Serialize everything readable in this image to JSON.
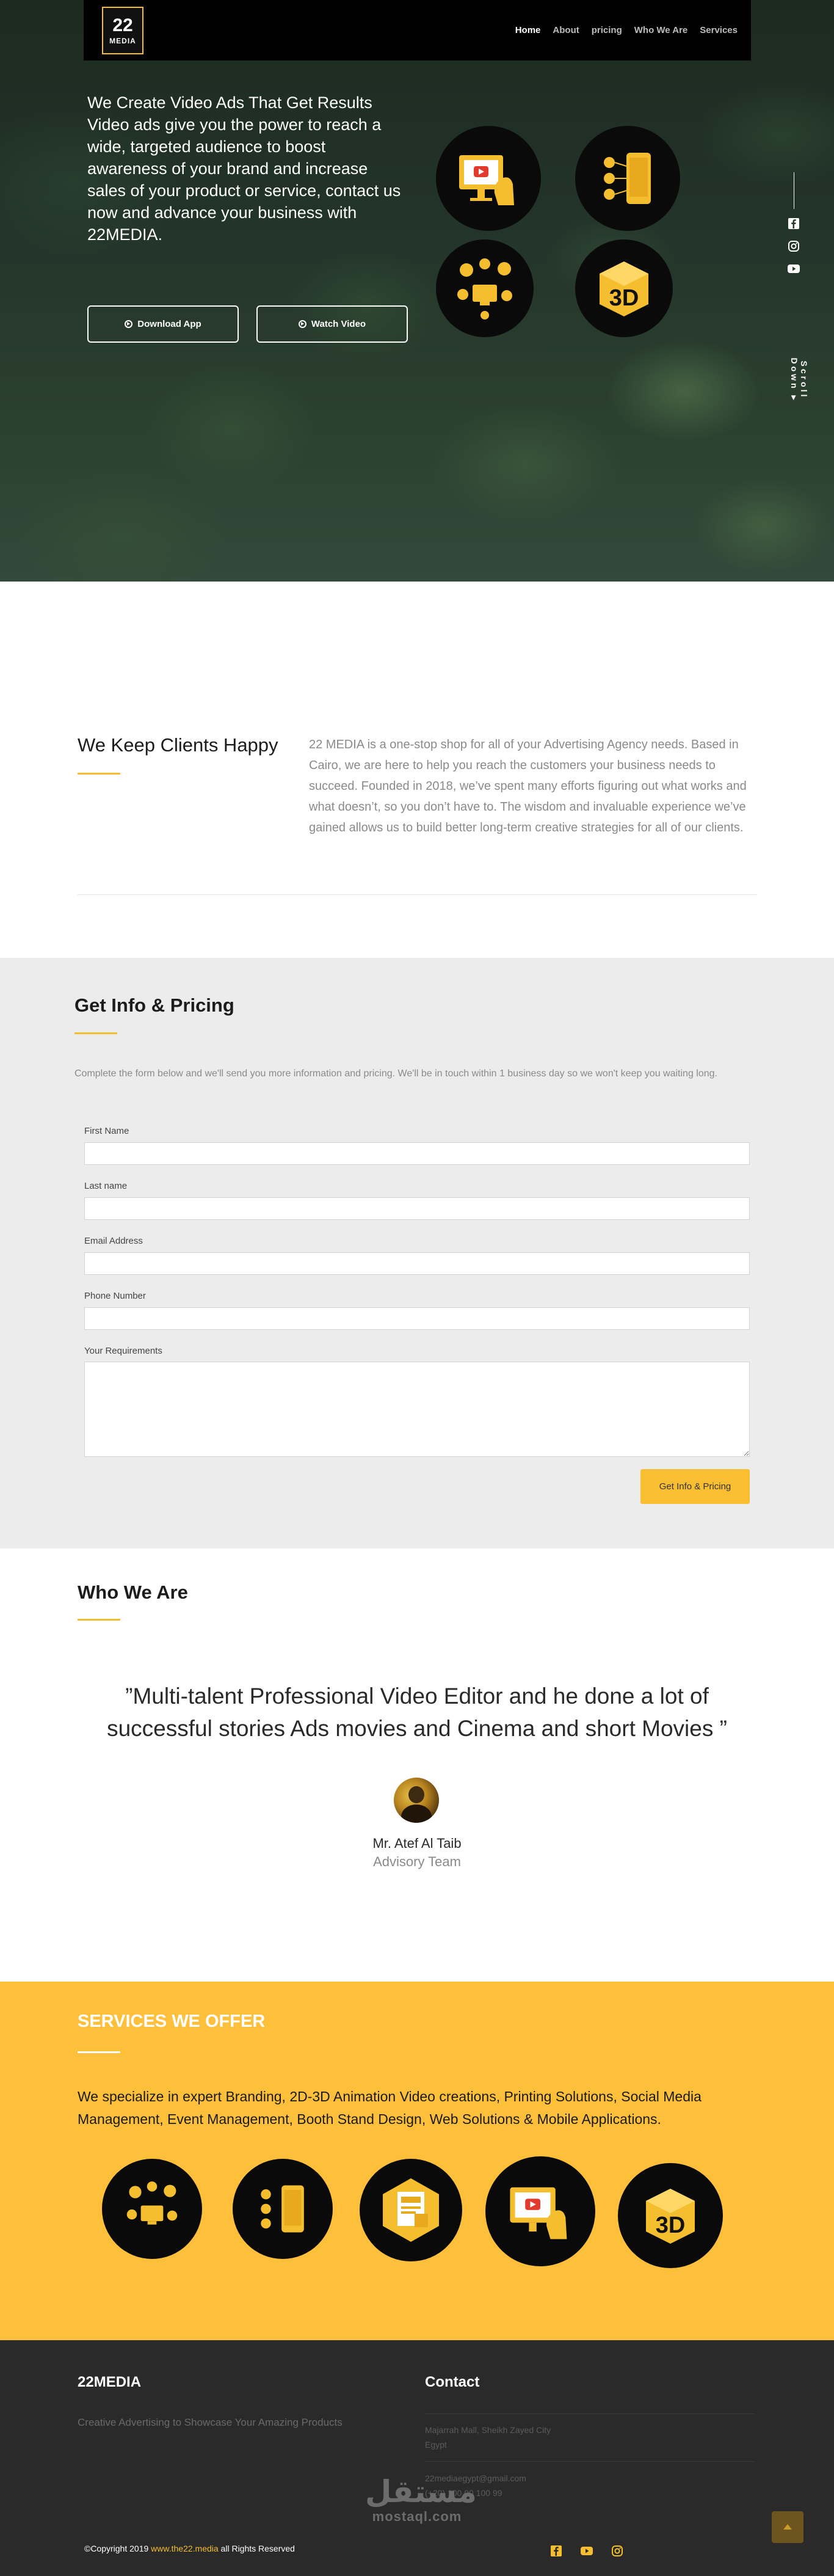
{
  "nav": {
    "logo_number": "22",
    "logo_text": "MEDIA",
    "links": [
      "Home",
      "About",
      "pricing",
      "Who We Are",
      "Services"
    ]
  },
  "hero": {
    "headline": "We Create Video Ads That Get Results Video ads give you the power to reach a wide, targeted audience to boost awareness of your brand and increase sales of your product or service, contact us now and advance your business with 22MEDIA.",
    "download_label": "Download App",
    "watch_label": "Watch Video",
    "scroll_label": "Scroll Down",
    "social_icons": [
      "facebook-icon",
      "instagram-icon",
      "youtube-icon"
    ]
  },
  "clients": {
    "title": "We Keep Clients Happy",
    "text": "22 MEDIA is a one-stop shop for all of your Advertising Agency needs. Based in Cairo, we are here to help you reach the customers your business needs to succeed. Founded in 2018, we’ve spent many efforts figuring out what works and what doesn’t, so you don’t have to. The wisdom and invaluable experience we’ve gained allows us to build better long-term creative strategies for all of our clients."
  },
  "pricing": {
    "title": "Get Info & Pricing",
    "description": "Complete the form below and we'll send you more information and pricing. We'll be in touch within 1 business day so we won't keep you waiting long.",
    "fields": {
      "first_name": "First Name",
      "last_name": "Last name",
      "email": "Email Address",
      "phone": "Phone Number",
      "requirements": "Your Requirements"
    },
    "submit_label": "Get Info & Pricing"
  },
  "who": {
    "title": "Who We Are",
    "quote": "”Multi-talent Professional Video Editor and he done a lot of successful stories Ads movies and Cinema and short Movies ”",
    "name": "Mr. Atef Al Taib",
    "role": "Advisory Team"
  },
  "services": {
    "title": "SERVICES WE OFFER",
    "description": "We specialize in expert Branding, 2D-3D Animation Video creations, Printing Solutions, Social Media Management, Event Management, Booth Stand Design, Web Solutions & Mobile Applications.",
    "badge_3d": "3D"
  },
  "footer": {
    "brand": "22MEDIA",
    "tagline": "Creative Advertising to Showcase Your Amazing Products",
    "contact_title": "Contact",
    "address_line1": "Majarrah Mall, Sheikh Zayed City",
    "address_line2": "Egypt",
    "email": "22mediaegypt@gmail.com",
    "phone": "(+20) 100 00 100 99",
    "copyright_prefix": "©Copyright 2019 ",
    "copyright_link": "www.the22.media",
    "copyright_suffix": " all Rights Reserved",
    "watermark_ar": "مستقل",
    "watermark_lat": "mostaql.com"
  },
  "colors": {
    "accent": "#f4be2f",
    "services_bg": "#fec03a",
    "footer_bg": "#2a2a2a",
    "form_bg": "#ececec"
  }
}
